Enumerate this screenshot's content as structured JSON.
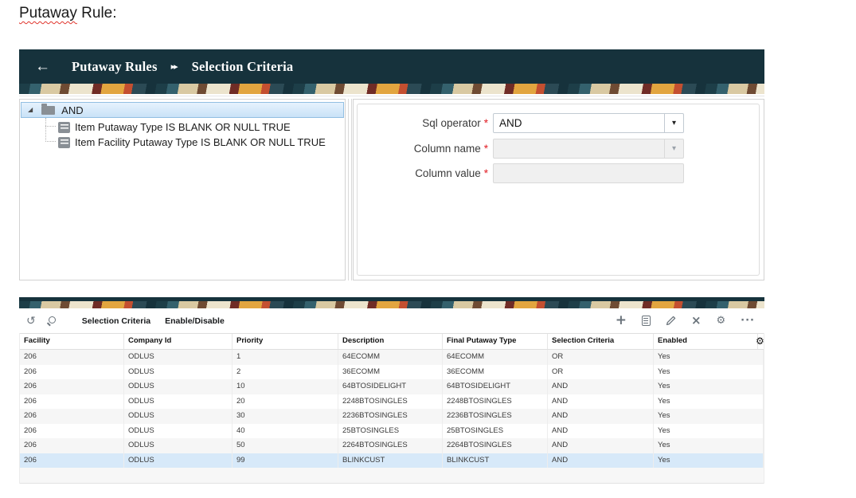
{
  "doc": {
    "title_word": "Putaway",
    "title_rest": " Rule:"
  },
  "header": {
    "back_glyph": "←",
    "separator_glyph": "▸▸",
    "breadcrumb": [
      "Putaway Rules",
      "Selection Criteria"
    ]
  },
  "tree": {
    "expand_glyph": "◢",
    "root_label": "AND",
    "children": [
      {
        "label": "Item Putaway Type IS BLANK OR NULL TRUE"
      },
      {
        "label": "Item Facility Putaway Type IS BLANK OR NULL TRUE"
      }
    ]
  },
  "form": {
    "dropdown_glyph": "▾",
    "fields": [
      {
        "label": "Sql operator",
        "marker": "*",
        "value": "AND",
        "type": "select",
        "disabled": false
      },
      {
        "label": "Column name",
        "marker": "*",
        "value": "",
        "type": "select",
        "disabled": true
      },
      {
        "label": "Column value",
        "marker": "*",
        "value": "",
        "type": "input",
        "disabled": true
      }
    ]
  },
  "toolbar": {
    "undo_glyph": "↺",
    "tabs": [
      {
        "label": "Selection Criteria"
      },
      {
        "label": "Enable/Disable"
      }
    ],
    "actions": {
      "add_glyph": "+",
      "delete_glyph": "×",
      "settings_glyph": "⚙",
      "more_glyph": "···"
    }
  },
  "table": {
    "corner_settings_glyph": "⚙",
    "columns": [
      "Facility",
      "Company Id",
      "Priority",
      "Description",
      "Final Putaway Type",
      "Selection Criteria",
      "Enabled"
    ],
    "rows": [
      [
        "206",
        "ODLUS",
        "1",
        "64ECOMM",
        "64ECOMM",
        "OR",
        "Yes"
      ],
      [
        "206",
        "ODLUS",
        "2",
        "36ECOMM",
        "36ECOMM",
        "OR",
        "Yes"
      ],
      [
        "206",
        "ODLUS",
        "10",
        "64BTOSIDELIGHT",
        "64BTOSIDELIGHT",
        "AND",
        "Yes"
      ],
      [
        "206",
        "ODLUS",
        "20",
        "2248BTOSINGLES",
        "2248BTOSINGLES",
        "AND",
        "Yes"
      ],
      [
        "206",
        "ODLUS",
        "30",
        "2236BTOSINGLES",
        "2236BTOSINGLES",
        "AND",
        "Yes"
      ],
      [
        "206",
        "ODLUS",
        "40",
        "25BTOSINGLES",
        "25BTOSINGLES",
        "AND",
        "Yes"
      ],
      [
        "206",
        "ODLUS",
        "50",
        "2264BTOSINGLES",
        "2264BTOSINGLES",
        "AND",
        "Yes"
      ],
      [
        "206",
        "ODLUS",
        "99",
        "BLINKCUST",
        "BLINKCUST",
        "AND",
        "Yes"
      ]
    ],
    "selected_row_index": 7
  },
  "colors": {
    "header_bar": "#16323c",
    "tree_selection_border": "#92bfe2",
    "tree_selection_fill": "#d4e7f8",
    "row_selected": "#d7e9f9",
    "row_stripe": "#f6f6f6",
    "required_marker": "#e11b22",
    "icon_gray": "#6a737b",
    "squiggle_red": "#e0342c",
    "pattern_palette": [
      "#1d3e48",
      "#34616d",
      "#d9c9a2",
      "#6f4b33",
      "#ece4cd",
      "#702c26",
      "#e2a53f",
      "#c44f30"
    ]
  }
}
